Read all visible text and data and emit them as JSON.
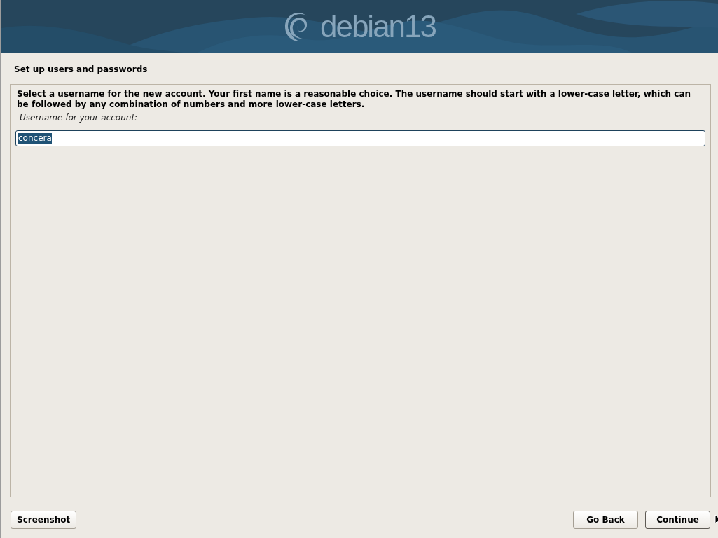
{
  "header": {
    "logo_text": "debian13"
  },
  "page_title": "Set up users and passwords",
  "panel": {
    "description": "Select a username for the new account. Your first name is a reasonable choice. The username should start with a lower-case letter, which can be followed by any combination of numbers and more lower-case letters.",
    "field": {
      "label": "Username for your account:",
      "value": "concera",
      "focused": true,
      "text_selected": true
    }
  },
  "left_buttons": [
    {
      "label": "Screenshot",
      "default": false
    }
  ],
  "right_buttons": [
    {
      "label": "Go Back",
      "default": false
    },
    {
      "label": "Continue",
      "default": true
    }
  ]
}
